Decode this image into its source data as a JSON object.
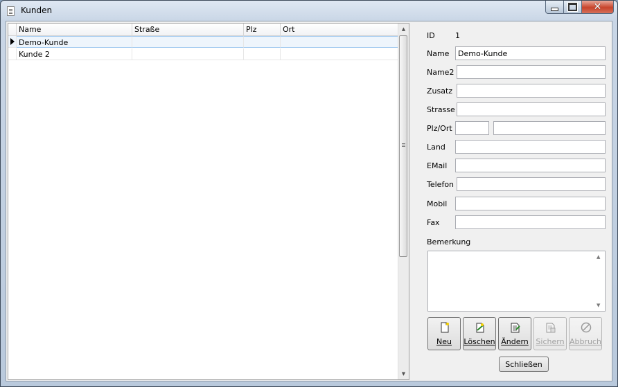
{
  "window": {
    "title": "Kunden"
  },
  "grid": {
    "columns": [
      "Name",
      "Straße",
      "Plz",
      "Ort"
    ],
    "rows": [
      {
        "name": "Demo-Kunde",
        "strasse": "",
        "plz": "",
        "ort": "",
        "selected": true
      },
      {
        "name": "Kunde 2",
        "strasse": "",
        "plz": "",
        "ort": "",
        "selected": false
      }
    ]
  },
  "form": {
    "id_label": "ID",
    "id_value": "1",
    "name_label": "Name",
    "name_value": "Demo-Kunde",
    "name2_label": "Name2",
    "name2_value": "",
    "zusatz_label": "Zusatz",
    "zusatz_value": "",
    "strasse_label": "Strasse",
    "strasse_value": "",
    "plzort_label": "Plz/Ort",
    "plz_value": "",
    "ort_value": "",
    "land_label": "Land",
    "land_value": "",
    "email_label": "EMail",
    "email_value": "",
    "telefon_label": "Telefon",
    "telefon_value": "",
    "mobil_label": "Mobil",
    "mobil_value": "",
    "fax_label": "Fax",
    "fax_value": "",
    "bemerkung_label": "Bemerkung",
    "bemerkung_value": ""
  },
  "buttons": {
    "neu": "Neu",
    "loeschen": "Löschen",
    "aendern": "Ändern",
    "sichern": "Sichern",
    "abbruch": "Abbruch",
    "schliessen": "Schließen"
  },
  "icons": {
    "app": "document-list-icon",
    "neu": "new-document-icon",
    "loeschen": "delete-document-icon",
    "aendern": "edit-document-icon",
    "sichern": "save-document-icon",
    "abbruch": "cancel-icon"
  }
}
